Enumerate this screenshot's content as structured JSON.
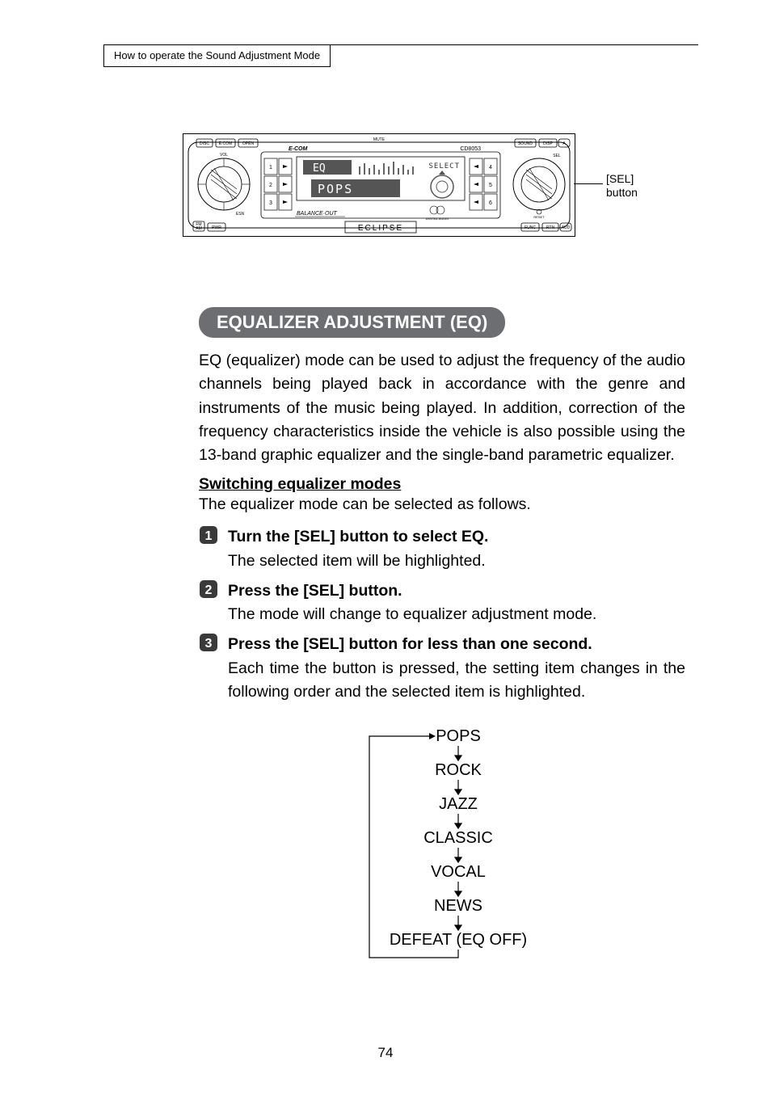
{
  "breadcrumb": "How to operate the Sound Adjustment Mode",
  "callout": {
    "line1": "[SEL]",
    "line2": "button"
  },
  "device": {
    "brand_left": "E-COM",
    "brand_right": "CD8053",
    "footer_brand": "ECLIPSE",
    "bottom_text": "BALANCE OUT",
    "lcd_top": "EQ",
    "lcd_top_right": "SELECT",
    "lcd_bottom": "POPS",
    "top_labels": [
      "DISC",
      "E.COM",
      "OPEN",
      "MUTE",
      "SOUND",
      "DISP",
      "DATA"
    ],
    "bottom_labels": [
      "FM",
      "AM",
      "PWR",
      "ESN",
      "FUNC",
      "RTN",
      "AUD"
    ],
    "side_label": "SEL",
    "inner_label": "RESET",
    "left_col": [
      "1",
      "2",
      "3"
    ],
    "right_col": [
      "4",
      "5",
      "6"
    ],
    "vol": "VOL"
  },
  "section": {
    "title": "EQUALIZER ADJUSTMENT (EQ)",
    "intro": "EQ (equalizer) mode can be used to adjust the frequency of the audio channels being played back in accordance with the genre and instruments of the music being played. In addition, correction of the frequency characteristics inside the vehicle is also possible using the 13-band graphic equalizer and the single-band parametric equalizer.",
    "subhead": "Switching equalizer modes",
    "follow": "The equalizer mode can be selected as follows."
  },
  "steps": [
    {
      "title": "Turn the [SEL] button to select EQ.",
      "desc": "The selected item will be highlighted."
    },
    {
      "title": "Press the [SEL] button.",
      "desc": "The mode will change to equalizer adjustment mode."
    },
    {
      "title": "Press the [SEL] button for less than one second.",
      "desc": "Each time the button is pressed, the setting item changes in the following order and the selected item is highlighted."
    }
  ],
  "cycle": [
    "POPS",
    "ROCK",
    "JAZZ",
    "CLASSIC",
    "VOCAL",
    "NEWS",
    "DEFEAT (EQ OFF)"
  ],
  "pageNumber": "74"
}
